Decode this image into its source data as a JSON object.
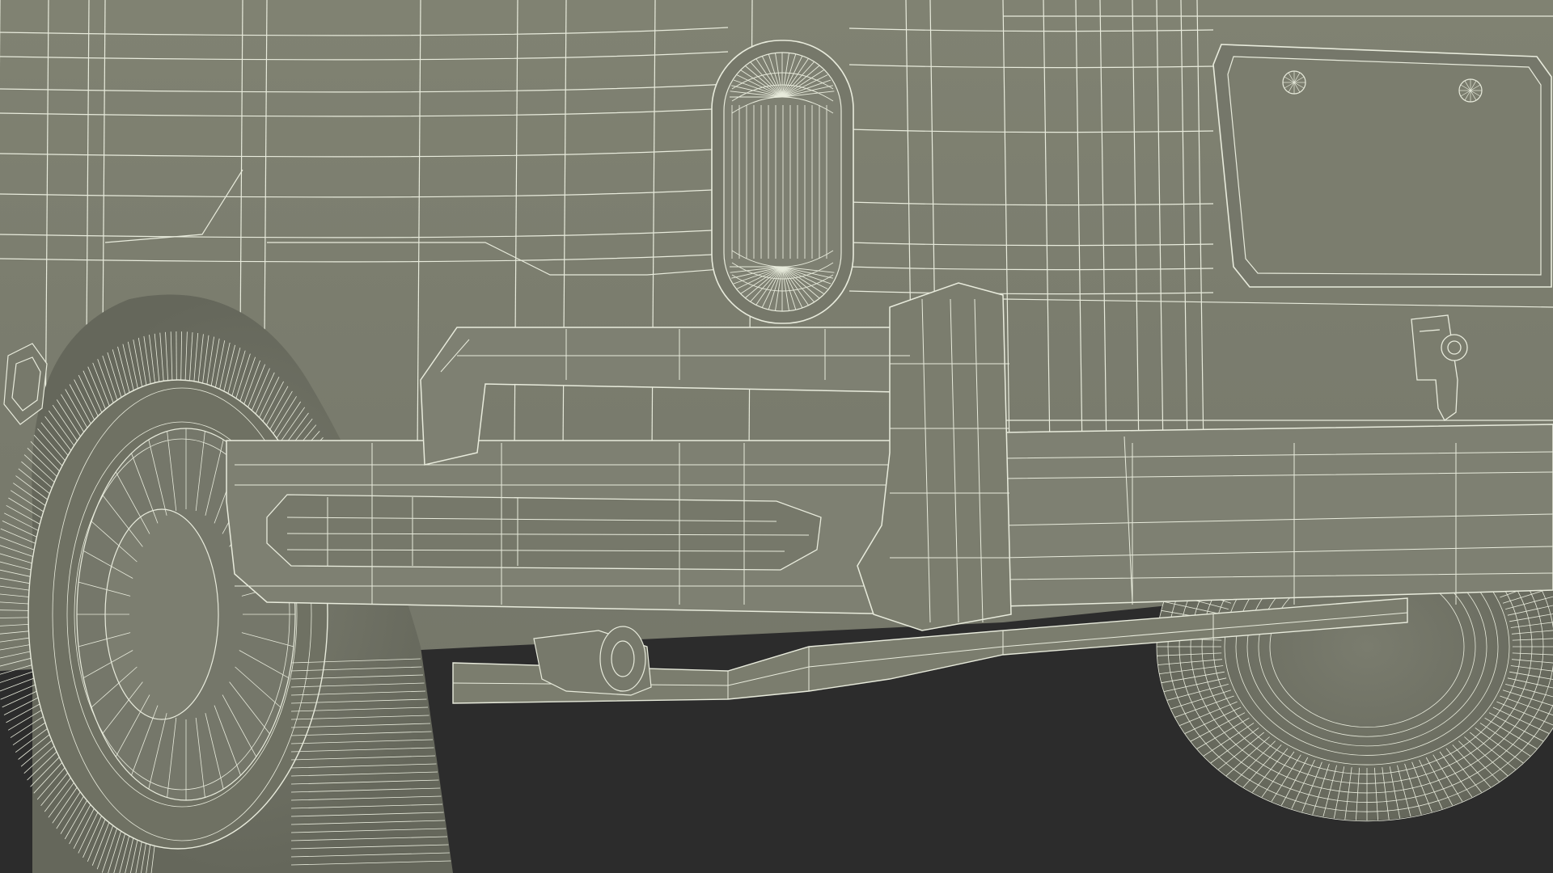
{
  "colors": {
    "background": "#2c2c2c",
    "body_surface": "#7b7d6e",
    "body_shadow": "#686a5d",
    "body_highlight": "#8a8c7d",
    "tire_surface": "#6f7163",
    "wireframe": "#e8ebdc",
    "wireframe_dense": "#dfe3d0"
  },
  "scene": {
    "description_free": true,
    "components": [
      "body-panel",
      "tail-light",
      "license-plate",
      "trailer-hitch-hook",
      "rear-bumper",
      "bumper-guard",
      "left-rear-tire",
      "right-rear-tire",
      "axle-bar"
    ]
  }
}
